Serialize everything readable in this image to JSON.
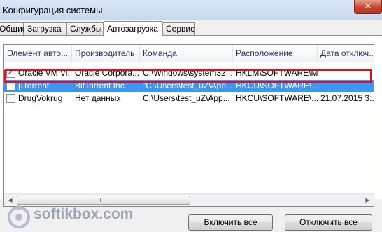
{
  "window": {
    "title": "Конфигурация системы",
    "close_symbol": "✕"
  },
  "tabs": [
    {
      "label": "Общие",
      "active": false
    },
    {
      "label": "Загрузка",
      "active": false
    },
    {
      "label": "Службы",
      "active": false
    },
    {
      "label": "Автозагрузка",
      "active": true
    },
    {
      "label": "Сервис",
      "active": false
    }
  ],
  "table": {
    "columns": [
      "Элемент авто...",
      "Производитель",
      "Команда",
      "Расположение",
      "Дата отключ..."
    ],
    "rows": [
      {
        "checked": true,
        "cells": [
          "Oracle VM Vi...",
          "Oracle Corpora...",
          "C:\\Windows\\system32...",
          "HKLM\\SOFTWARE\\M...",
          ""
        ]
      },
      {
        "checked": false,
        "selected": true,
        "cells": [
          "µTorrent",
          "BitTorrent Inc.",
          "\"C:\\Users\\test_uZ\\App...",
          "HKCU\\SOFTWARE\\...",
          ""
        ]
      },
      {
        "checked": false,
        "cells": [
          "DrugVokrug",
          "Нет данных",
          "C:\\Users\\test_uZ\\App...",
          "HKCU\\SOFTWARE\\...",
          "21.07.2015 3:..."
        ]
      }
    ],
    "check_mark": "✓"
  },
  "scrollbar": {
    "left_arrow": "◀",
    "right_arrow": "▶"
  },
  "buttons": {
    "enable_all": "Включить все",
    "disable_all": "Отключить все"
  },
  "watermark": {
    "text": "softikbox.com"
  },
  "colors": {
    "selection": "#3399ff",
    "highlight_border": "#e0101a",
    "close_button": "#c9452f"
  }
}
